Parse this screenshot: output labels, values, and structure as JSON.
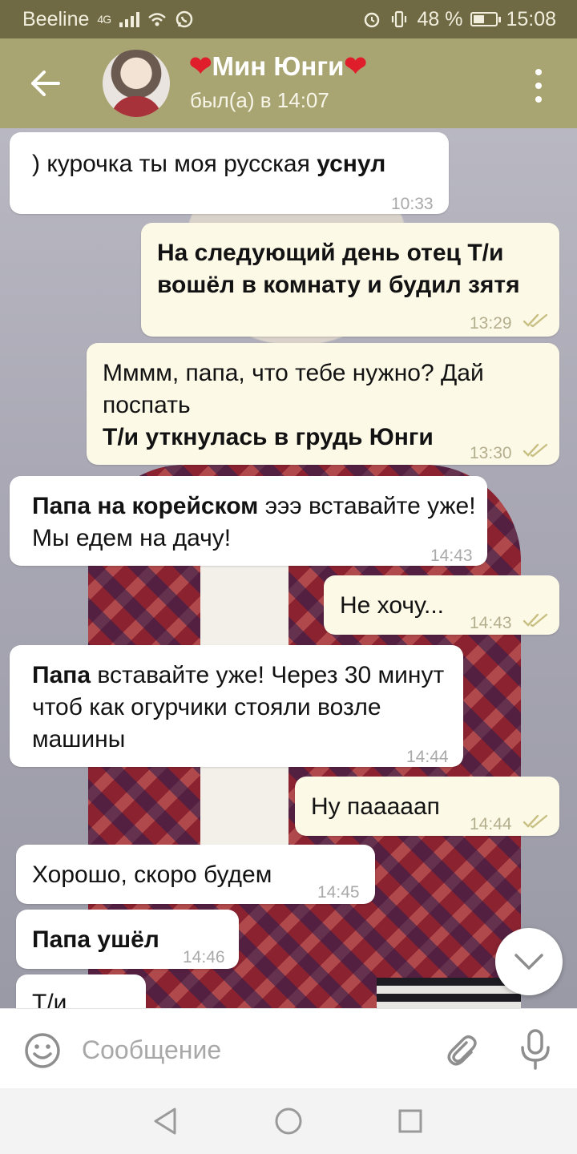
{
  "status_bar": {
    "carrier": "Beeline",
    "signal": "4G",
    "battery": "48 %",
    "battery_level": 0.48,
    "time": "15:08"
  },
  "header": {
    "heart": "❤",
    "contact_name": "Мин Юнги",
    "last_seen": "был(а) в 14:07"
  },
  "messages": [
    {
      "side": "in",
      "parts": [
        {
          "t": ") курочка ты моя русская "
        },
        {
          "t": "уснул",
          "b": true
        }
      ],
      "time": "10:33"
    },
    {
      "side": "out",
      "parts": [
        {
          "t": "На следующий день отец Т/и вошёл в комнату и будил зятя",
          "b": true
        }
      ],
      "time": "13:29"
    },
    {
      "side": "out",
      "parts": [
        {
          "t": "Мммм, папа, что тебе нужно? Дай поспать"
        },
        {
          "t": "Т/и уткнулась в грудь Юнги",
          "b": true
        }
      ],
      "time": "13:30"
    },
    {
      "side": "in",
      "parts": [
        {
          "t": "Папа на корейском",
          "b": true
        },
        {
          "t": " эээ вставайте уже! Мы едем на дачу!"
        }
      ],
      "time": "14:43"
    },
    {
      "side": "out",
      "parts": [
        {
          "t": "Не хочу..."
        }
      ],
      "time": "14:43"
    },
    {
      "side": "in",
      "parts": [
        {
          "t": "Папа",
          "b": true
        },
        {
          "t": " вставайте уже! Через 30 минут чтоб как огурчики стояли возле машины"
        }
      ],
      "time": "14:44"
    },
    {
      "side": "out",
      "parts": [
        {
          "t": "Ну пааааап"
        }
      ],
      "time": "14:44"
    },
    {
      "side": "in",
      "parts": [
        {
          "t": "Хорошо, скоро будем"
        }
      ],
      "time": "14:45"
    },
    {
      "side": "in",
      "parts": [
        {
          "t": "Папа ушёл",
          "b": true
        }
      ],
      "time": "14:46"
    },
    {
      "side": "in",
      "parts": [
        {
          "t": "Т/и",
          "b": false
        }
      ],
      "time": ""
    }
  ],
  "input": {
    "placeholder": "Сообщение"
  },
  "icons": {
    "back": "arrow-left-icon",
    "menu": "more-vertical-icon",
    "scroll_down": "chevron-down-icon",
    "emoji": "smiley-icon",
    "attach": "paperclip-icon",
    "mic": "microphone-icon"
  },
  "colors": {
    "header": "#a8a572",
    "status_bar": "#6f6a44",
    "outgoing_bubble": "#fdf9e7",
    "incoming_bubble": "#ffffff",
    "read_ticks": "#c8c083",
    "heart": "#e01e2b"
  }
}
